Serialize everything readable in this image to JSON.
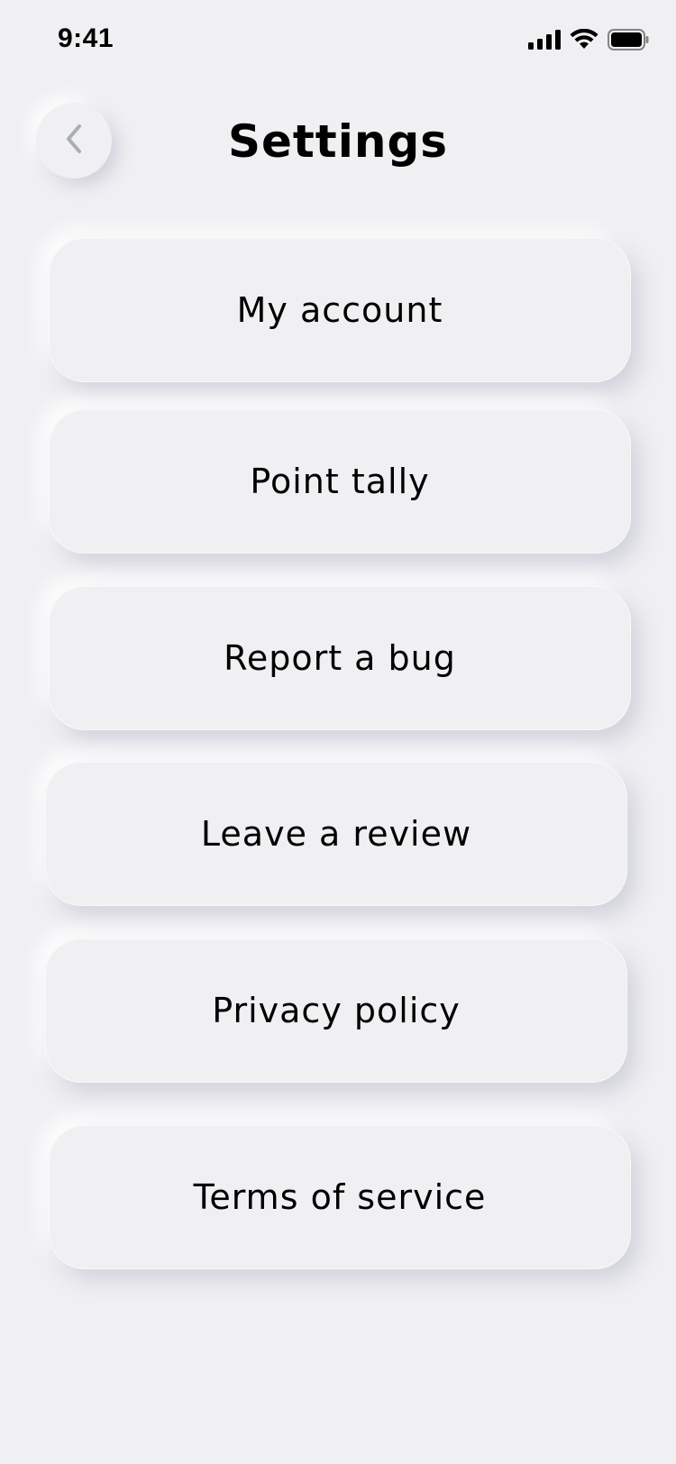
{
  "status_bar": {
    "time": "9:41",
    "icons": [
      "cellular-signal-icon",
      "wifi-icon",
      "battery-icon"
    ]
  },
  "header": {
    "back_icon": "chevron-left-icon",
    "title": "Settings"
  },
  "menu": {
    "items": [
      {
        "label": "My account"
      },
      {
        "label": "Point tally"
      },
      {
        "label": "Report a bug"
      },
      {
        "label": "Leave a review"
      },
      {
        "label": "Privacy policy"
      },
      {
        "label": "Terms of service"
      }
    ]
  },
  "colors": {
    "background": "#F0F0F3",
    "text": "#000000",
    "back_chevron": "#A7AEB5"
  }
}
